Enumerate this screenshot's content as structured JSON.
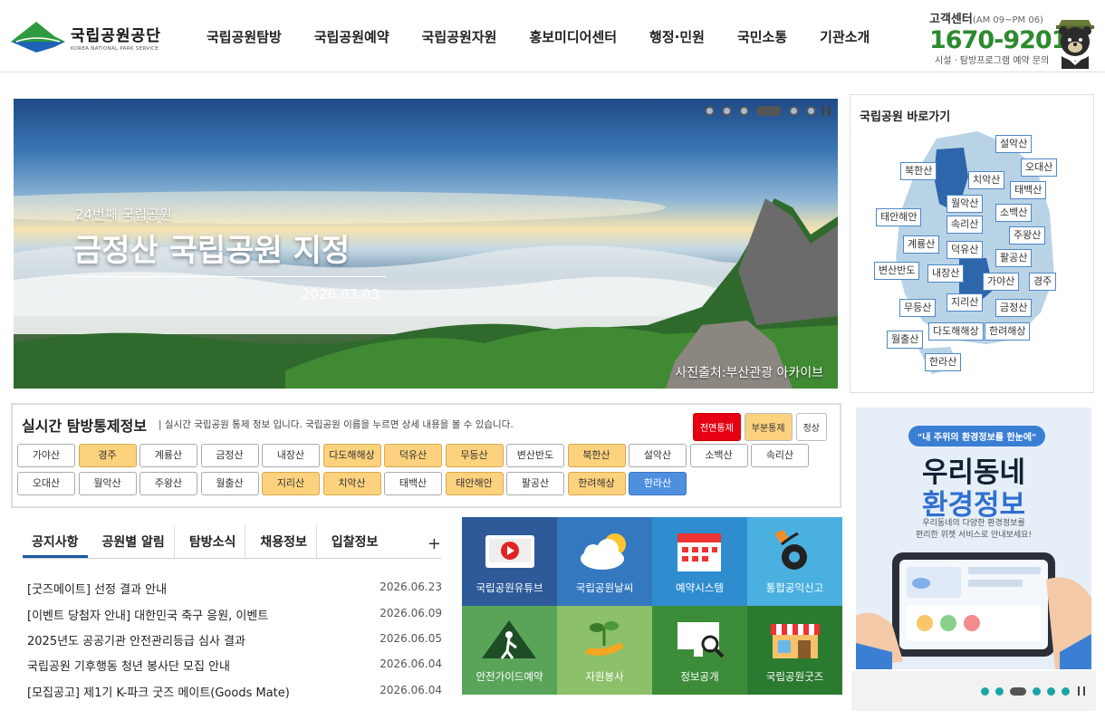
{
  "header": {
    "logo_title": "국립공원공단",
    "logo_sub": "KOREA NATIONAL PARK SERVICE",
    "nav": [
      "국립공원탐방",
      "국립공원예약",
      "국립공원자원",
      "홍보미디어센터",
      "행정·민원",
      "국민소통",
      "기관소개"
    ],
    "cs_title": "고객센터",
    "cs_hours": "(AM 09~PM 06)",
    "cs_phone": "1670-9201",
    "cs_note": "시설 · 탐방프로그램 예약 문의"
  },
  "hero": {
    "subtitle": "24번째 국립공원",
    "title": "금정산 국립공원 지정",
    "date": "2026.03.03",
    "credit": "사진출처:부산관광 아카이브",
    "slide_count": 6,
    "active_slide": 4
  },
  "parkmap": {
    "title": "국립공원 바로가기",
    "parks": [
      "설악산",
      "오대산",
      "북한산",
      "치악산",
      "태백산",
      "월악산",
      "태안해안",
      "소백산",
      "속리산",
      "계룡산",
      "덕유산",
      "주왕산",
      "팔공산",
      "변산반도",
      "내장산",
      "가야산",
      "경주",
      "지리산",
      "무등산",
      "금정산",
      "다도해해상",
      "한려해상",
      "월출산",
      "한라산"
    ]
  },
  "control": {
    "title": "실시간 탐방통제정보",
    "desc": "| 실시간 국립공원 통제 정보 입니다. 국립공원 이름을 누르면 상세 내용을 볼 수 있습니다.",
    "legend_full": "전면통제",
    "legend_partial": "부분통제",
    "legend_normal": "정상",
    "row1": [
      {
        "name": "가야산",
        "status": "normal"
      },
      {
        "name": "경주",
        "status": "partial"
      },
      {
        "name": "계룡산",
        "status": "normal"
      },
      {
        "name": "금정산",
        "status": "normal"
      },
      {
        "name": "내장산",
        "status": "normal"
      },
      {
        "name": "다도해해상",
        "status": "partial"
      },
      {
        "name": "덕유산",
        "status": "partial"
      },
      {
        "name": "무등산",
        "status": "partial"
      },
      {
        "name": "변산반도",
        "status": "normal"
      },
      {
        "name": "북한산",
        "status": "partial"
      },
      {
        "name": "설악산",
        "status": "normal"
      },
      {
        "name": "소백산",
        "status": "normal"
      },
      {
        "name": "속리산",
        "status": "normal"
      }
    ],
    "row2": [
      {
        "name": "오대산",
        "status": "normal"
      },
      {
        "name": "월악산",
        "status": "normal"
      },
      {
        "name": "주왕산",
        "status": "normal"
      },
      {
        "name": "월출산",
        "status": "normal"
      },
      {
        "name": "지리산",
        "status": "partial"
      },
      {
        "name": "치악산",
        "status": "partial"
      },
      {
        "name": "태백산",
        "status": "normal"
      },
      {
        "name": "태안해안",
        "status": "partial"
      },
      {
        "name": "팔공산",
        "status": "normal"
      },
      {
        "name": "한려해상",
        "status": "partial"
      },
      {
        "name": "한라산",
        "status": "selected"
      }
    ]
  },
  "news": {
    "tabs": [
      "공지사항",
      "공원별 알림",
      "탐방소식",
      "채용정보",
      "입찰정보"
    ],
    "plus": "+",
    "items": [
      {
        "title": "[굿즈메이트] 선정 결과 안내",
        "date": "2026.06.23"
      },
      {
        "title": "[이벤트 당첨자 안내] 대한민국 축구 응원, 이벤트",
        "date": "2026.06.09"
      },
      {
        "title": "2025년도 공공기관 안전관리등급 심사 결과",
        "date": "2026.06.05"
      },
      {
        "title": "국립공원 기후행동 청년 봉사단 모집 안내",
        "date": "2026.06.04"
      },
      {
        "title": "[모집공고] 제1기 K-파크 굿즈 메이트(Goods Mate)",
        "date": "2026.06.04"
      }
    ]
  },
  "tiles": [
    {
      "label": "국립공원유튜브",
      "color": "#2e5a9a",
      "icon": "youtube-icon"
    },
    {
      "label": "국립공원날씨",
      "color": "#3478c0",
      "icon": "weather-icon"
    },
    {
      "label": "예약시스템",
      "color": "#2f8dcf",
      "icon": "calendar-icon"
    },
    {
      "label": "통합공익신고",
      "color": "#4ab0e0",
      "icon": "phone-icon"
    },
    {
      "label": "안전가이드예약",
      "color": "#5aa45a",
      "icon": "hiker-icon"
    },
    {
      "label": "자원봉사",
      "color": "#8cc06a",
      "icon": "sprout-icon"
    },
    {
      "label": "정보공개",
      "color": "#3d8c3a",
      "icon": "monitor-search-icon"
    },
    {
      "label": "국립공원굿즈",
      "color": "#2a7a30",
      "icon": "shop-icon"
    }
  ],
  "ad": {
    "chip": "\"내 주위의 환경정보를 한눈에\"",
    "title1": "우리동네",
    "title2": "환경정보",
    "desc1": "우리동네의 다양한 환경정보를",
    "desc2": "편리한 위젯 서비스로 안내보세요!",
    "slide_count": 6,
    "active_slide": 3
  }
}
